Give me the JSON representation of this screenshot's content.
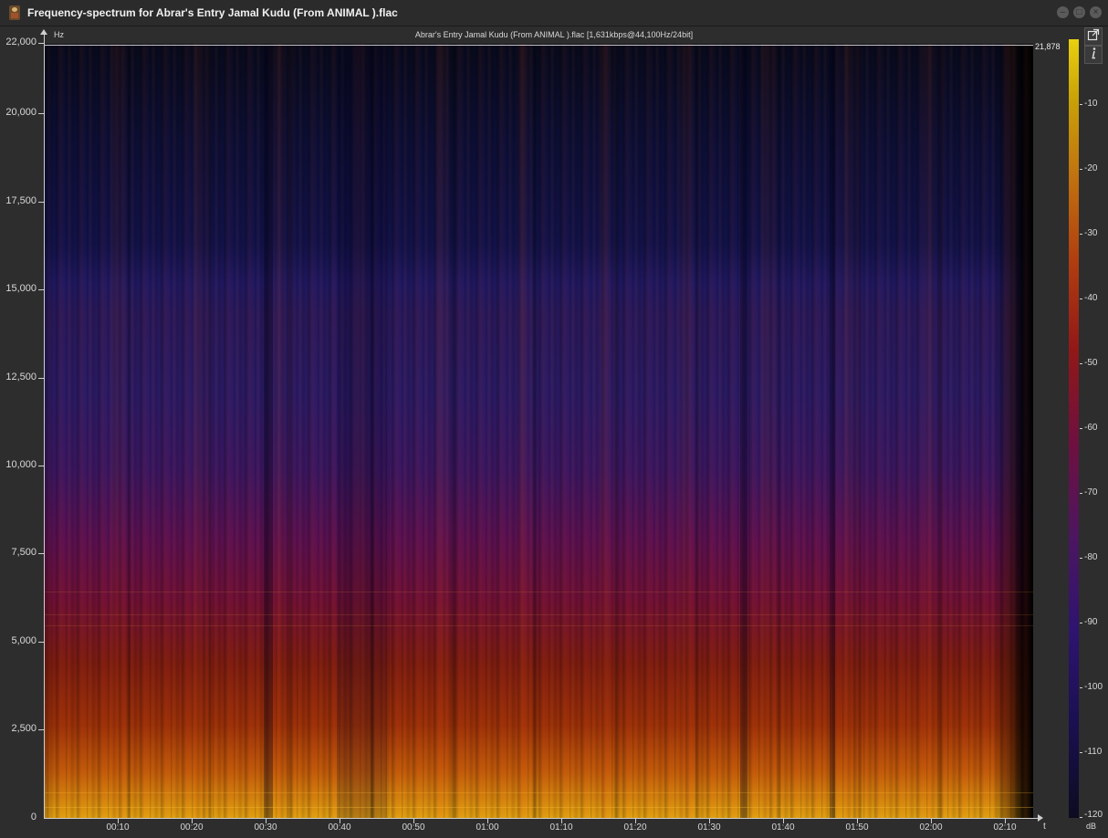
{
  "window": {
    "title": "Frequency-spectrum for Abrar's Entry Jamal Kudu (From  ANIMAL ).flac",
    "controls": [
      "minimize",
      "maximize",
      "close"
    ]
  },
  "spectrogram": {
    "info": "Abrar's Entry Jamal Kudu (From  ANIMAL ).flac [1,631kbps@44,100Hz/24bit]",
    "y_unit": "Hz",
    "x_unit": "t",
    "max_freq_label": "21,878",
    "y_ticks": [
      "22,000",
      "20,000",
      "17,500",
      "15,000",
      "12,500",
      "10,000",
      "7,500",
      "5,000",
      "2,500",
      "0"
    ],
    "x_ticks": [
      "00:10",
      "00:20",
      "00:30",
      "00:40",
      "00:50",
      "01:00",
      "01:10",
      "01:20",
      "01:30",
      "01:40",
      "01:50",
      "02:00",
      "02:10"
    ],
    "colorbar_unit": "dB",
    "colorbar_ticks": [
      "-10",
      "-20",
      "-30",
      "-40",
      "-50",
      "-60",
      "-70",
      "-80",
      "-90",
      "-100",
      "-110",
      "-120"
    ]
  },
  "toolbar": {
    "export_icon": "external-link-icon",
    "info_icon": "info-icon"
  }
}
